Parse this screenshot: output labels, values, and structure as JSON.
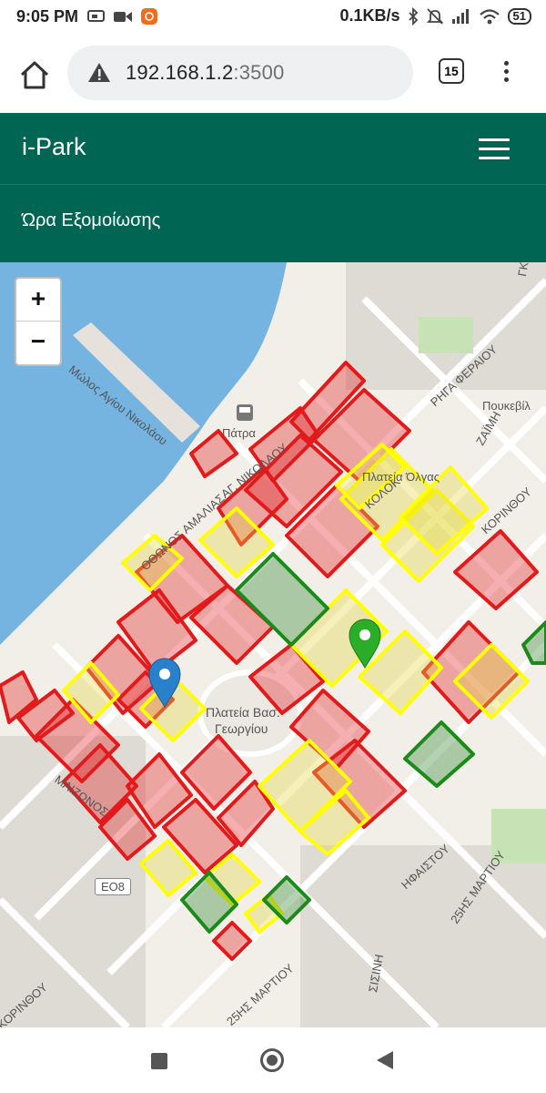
{
  "status_bar": {
    "time": "9:05 PM",
    "network_speed": "0.1KB/s",
    "battery": "51",
    "icons": [
      "message-icon",
      "video-icon",
      "app-notification-icon",
      "bluetooth-icon",
      "mute-icon",
      "signal-icon",
      "wifi-icon",
      "battery-icon"
    ]
  },
  "browser": {
    "url_host": "192.168.1.2",
    "url_port": ":3500",
    "tab_count": "15",
    "icons": [
      "home-icon",
      "warning-icon",
      "tabs-icon",
      "kebab-menu-icon"
    ]
  },
  "app": {
    "title": "i-Park",
    "subtitle": "Ώρα Εξομοίωσης",
    "menu_icon": "hamburger-icon"
  },
  "map": {
    "zoom_in": "+",
    "zoom_out": "−",
    "labels": {
      "patra": "Πάτρα",
      "molos": "Μώλος Αγίου Νικολάου",
      "plateia_olgas": "Πλατεία Όλγας",
      "plateia_georgiou_1": "Πλατεία Βασ.",
      "plateia_georgiou_2": "Γεωργίου",
      "rhga_feraiou": "ΡΗΓΑ ΦΕΡΑΙΟΥ",
      "zaimi": "ΖΑΪΜΗ",
      "korinthou_top": "ΚΟΡΙΝΘΟΥ",
      "korinthou_bottom": "ΚΟΡΙΝΘΟΥ",
      "martiou_25_1": "25ΗΣ ΜΑΡΤΙΟΥ",
      "martiou_25_2": "25ΗΣ ΜΑΡΤΙΟΥ",
      "ifaistou": "ΗΦΑΙΣΤΟΥ",
      "eo8": "ΕΟ8",
      "othonos_amalias": "ΟΘΩΝΟΣ ΑΜΑΛΙΑΣ",
      "sisini": "ΣΙΣΙΝΗ",
      "gkotsi": "ΓΚΟ",
      "poukevil": "Πουκεβίλ",
      "mezonos": "ΜΑΙΖΩΝΟΣ",
      "ag_nikolaou": "ΑΓ. ΝΙΚΟΛΑΟΥ",
      "kolokotroni": "ΚΟΛΟΚ"
    },
    "zone_colors": {
      "occupied": "#e31a1c",
      "partial": "#ffff00",
      "free": "#1a8a1a"
    },
    "markers": [
      {
        "name": "blue-marker",
        "color": "#2a81cb"
      },
      {
        "name": "green-marker",
        "color": "#2aad27"
      }
    ]
  },
  "nav": {
    "icons": [
      "recent-apps-icon",
      "home-nav-icon",
      "back-icon"
    ]
  }
}
